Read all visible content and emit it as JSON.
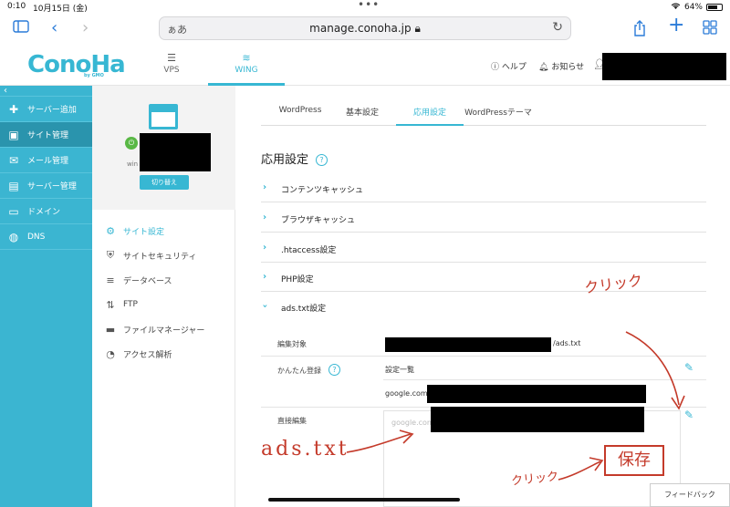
{
  "status": {
    "time": "0:10",
    "date": "10月15日 (金)",
    "battery": "64%"
  },
  "browser": {
    "address_prefix": "ぁあ",
    "url": "manage.conoha.jp"
  },
  "header": {
    "logo": "ConoHa",
    "logo_sub": "by GMO",
    "tabs": [
      {
        "label": "VPS"
      },
      {
        "label": "WING"
      }
    ],
    "help": "ヘルプ",
    "notice": "お知らせ"
  },
  "leftnav": {
    "items": [
      {
        "label": "サーバー追加"
      },
      {
        "label": "サイト管理"
      },
      {
        "label": "メール管理"
      },
      {
        "label": "サーバー管理"
      },
      {
        "label": "ドメイン"
      },
      {
        "label": "DNS"
      }
    ]
  },
  "subpanel": {
    "server_prefix": "win",
    "switch_label": "切り替え",
    "items": [
      {
        "label": "サイト設定"
      },
      {
        "label": "サイトセキュリティ"
      },
      {
        "label": "データベース"
      },
      {
        "label": "FTP"
      },
      {
        "label": "ファイルマネージャー"
      },
      {
        "label": "アクセス解析"
      }
    ]
  },
  "main": {
    "tabs": [
      {
        "label": "WordPress"
      },
      {
        "label": "基本設定"
      },
      {
        "label": "応用設定"
      },
      {
        "label": "WordPressテーマ"
      }
    ],
    "title": "応用設定",
    "accordions": [
      {
        "label": "コンテンツキャッシュ"
      },
      {
        "label": "ブラウザキャッシュ"
      },
      {
        "label": ".htaccess設定"
      },
      {
        "label": "PHP設定"
      },
      {
        "label": "ads.txt設定"
      }
    ],
    "ads": {
      "target_label": "編集対象",
      "target_suffix": "/ads.txt",
      "easy_label": "かんたん登録",
      "settings_list": "設定一覧",
      "entry_prefix": "google.com,",
      "direct_label": "直接編集",
      "textarea_prefix": "google.com"
    },
    "feedback": "フィードバック"
  },
  "annotations": {
    "click_top": "クリック",
    "ads_file": "ads.txt",
    "click_bottom": "クリック",
    "save": "保存"
  }
}
